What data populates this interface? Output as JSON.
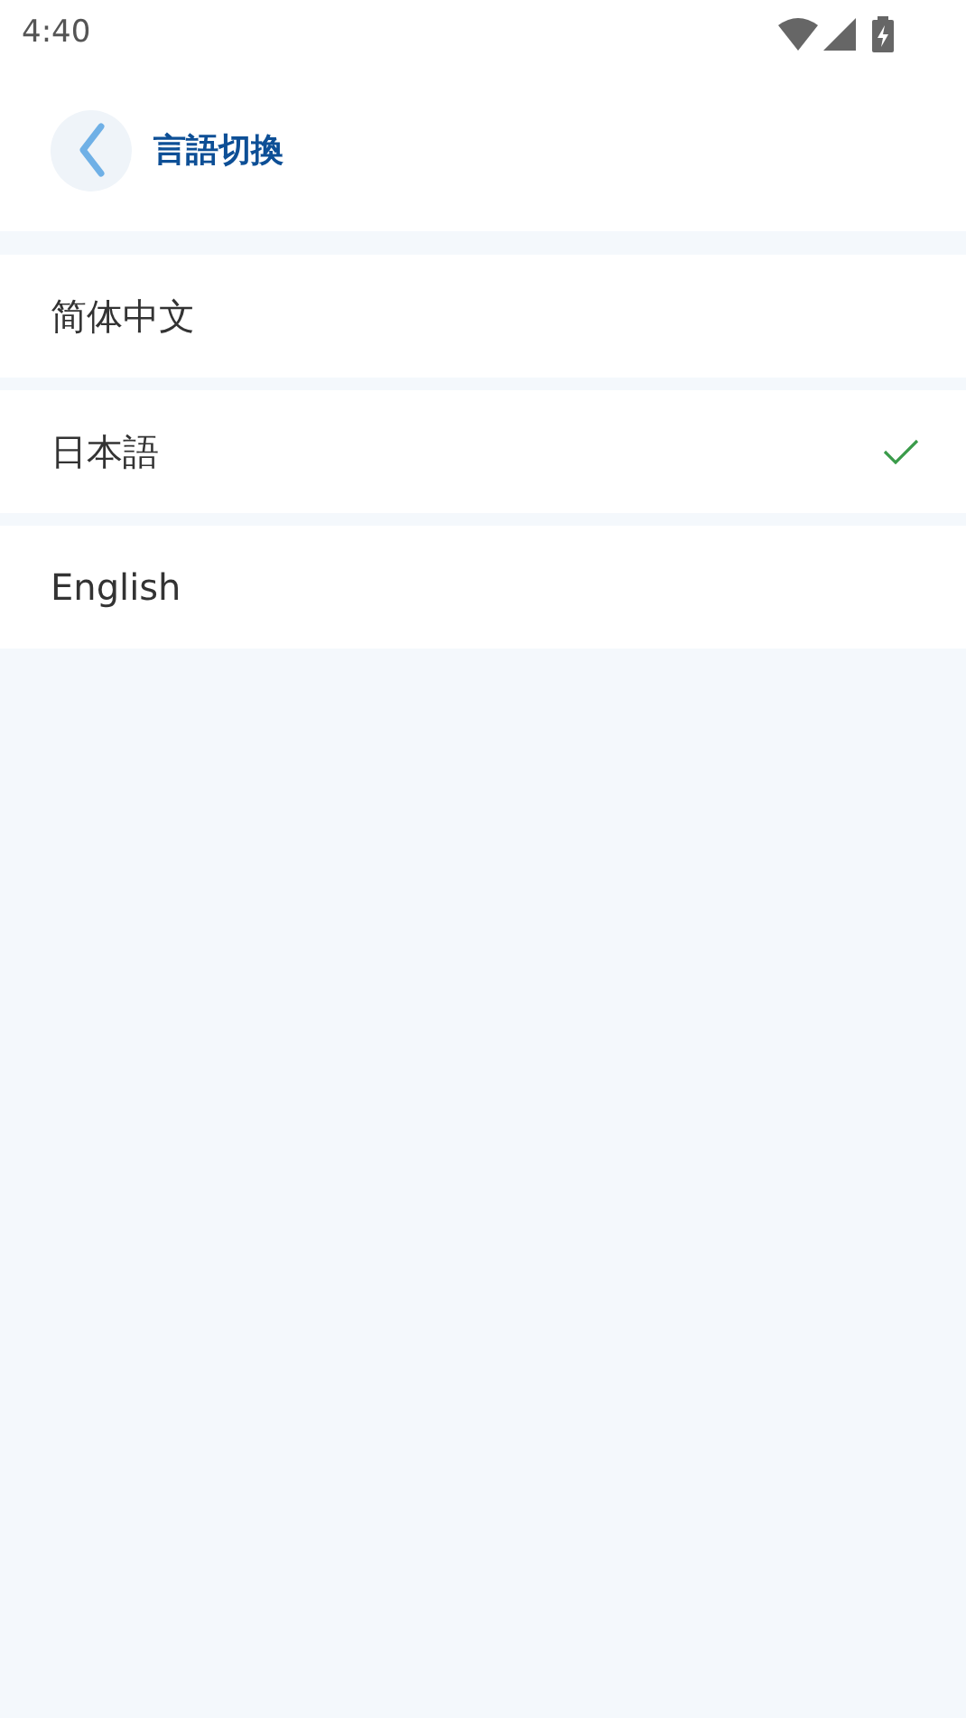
{
  "status_bar": {
    "time": "4:40"
  },
  "header": {
    "title": "言語切換"
  },
  "languages": [
    {
      "label": "简体中文",
      "selected": false
    },
    {
      "label": "日本語",
      "selected": true
    },
    {
      "label": "English",
      "selected": false
    }
  ]
}
